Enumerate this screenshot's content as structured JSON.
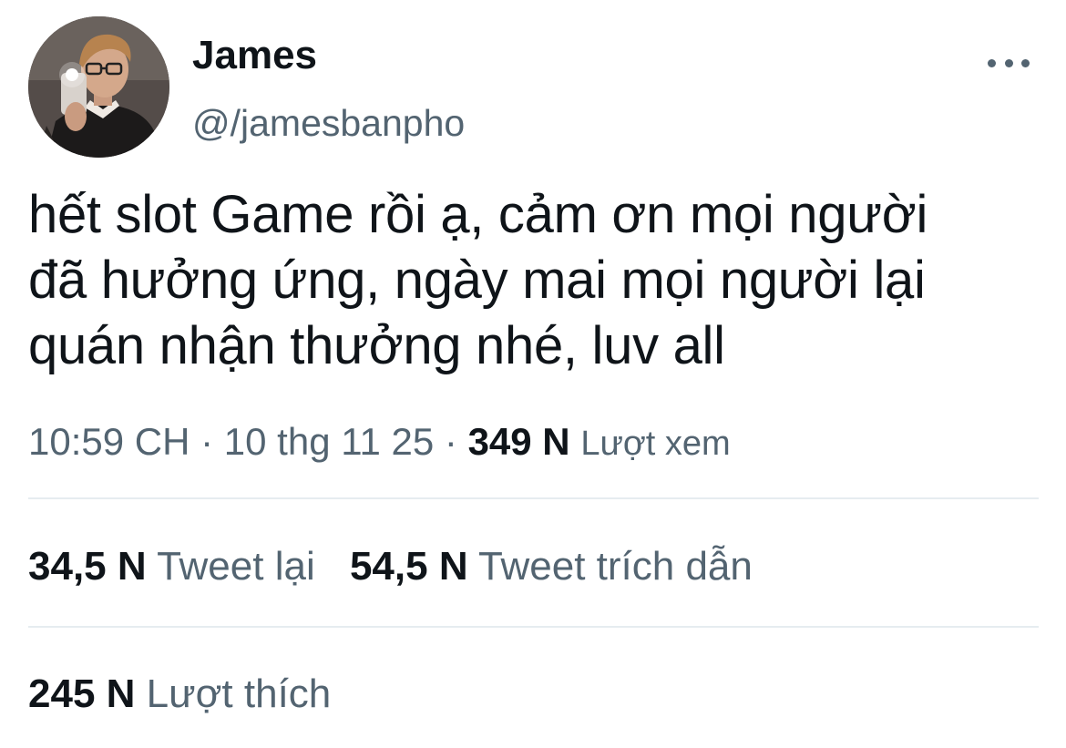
{
  "user": {
    "display_name": "James",
    "handle": "@/jamesbanpho"
  },
  "more_icon": "more-horizontal-icon",
  "tweet": {
    "lines": [
      "hết slot Game rồi ạ, cảm ơn mọi người",
      "đã hưởng ứng, ngày mai mọi người lại",
      "quán nhận thưởng nhé, luv all"
    ]
  },
  "meta": {
    "time": "10:59 CH",
    "separator": "·",
    "date": "10 thg 11 25",
    "views_count": "349 N",
    "views_label": "Lượt xem"
  },
  "stats": {
    "retweets_count": "34,5 N",
    "retweets_label": "Tweet lại",
    "quotes_count": "54,5 N",
    "quotes_label": "Tweet trích dẫn",
    "likes_count": "245 N",
    "likes_label": "Lượt thích"
  },
  "colors": {
    "text_primary": "#0f1419",
    "text_secondary": "#536471",
    "divider": "#e6ecf0"
  }
}
